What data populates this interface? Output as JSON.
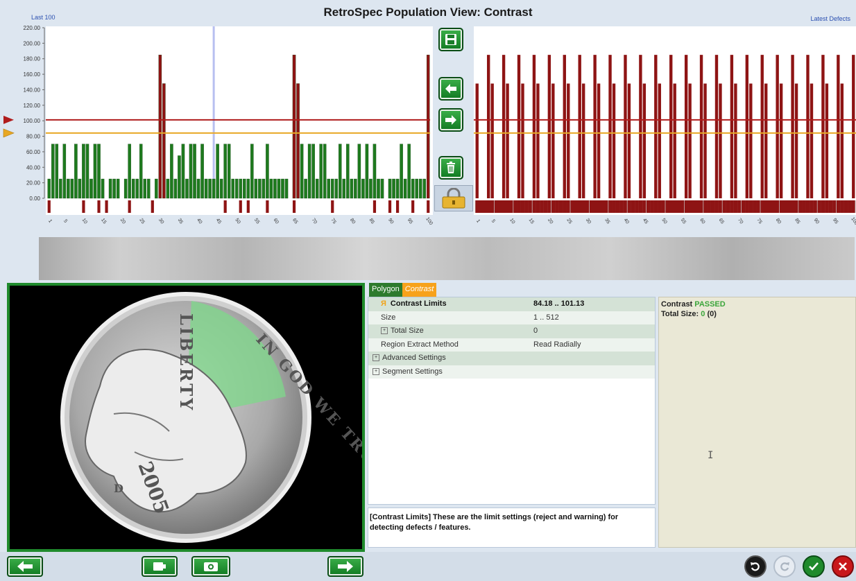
{
  "header": {
    "title": "RetroSpec Population View:  Contrast",
    "left_label": "Last 100",
    "right_label": "Latest Defects"
  },
  "colors": {
    "reject": "#b01c1c",
    "warning": "#e8a824",
    "pass_bar": "#1e7a1e",
    "defect_bar": "#8e1414",
    "accent_green": "#1f8a2c"
  },
  "chart_data": [
    {
      "type": "bar",
      "title": "Last 100",
      "yticks": [
        "220.00",
        "200.00",
        "180.00",
        "160.00",
        "140.00",
        "120.00",
        "100.00",
        "80.00",
        "60.00",
        "40.00",
        "20.00",
        "0.00"
      ],
      "xticks": [
        "1",
        "5",
        "10",
        "15",
        "20",
        "25",
        "30",
        "35",
        "40",
        "45",
        "50",
        "55",
        "60",
        "65",
        "70",
        "75",
        "80",
        "85",
        "90",
        "95",
        "100"
      ],
      "ylim": [
        0,
        220
      ],
      "reject_limit": 101.13,
      "warning_limit": 84.18,
      "cursor_x": 44,
      "values": [
        25,
        70,
        70,
        25,
        70,
        25,
        25,
        70,
        25,
        70,
        70,
        25,
        70,
        70,
        25,
        0,
        25,
        25,
        25,
        0,
        25,
        70,
        25,
        25,
        70,
        25,
        25,
        0,
        25,
        185,
        148,
        25,
        70,
        25,
        55,
        70,
        25,
        70,
        70,
        25,
        70,
        25,
        25,
        25,
        70,
        25,
        70,
        70,
        25,
        25,
        25,
        25,
        25,
        70,
        25,
        25,
        25,
        70,
        25,
        25,
        25,
        25,
        25,
        0,
        185,
        148,
        70,
        25,
        70,
        70,
        25,
        70,
        70,
        25,
        25,
        25,
        70,
        25,
        70,
        25,
        25,
        70,
        25,
        70,
        25,
        70,
        25,
        25,
        0,
        25,
        25,
        25,
        70,
        25,
        70,
        25,
        25,
        25,
        25,
        185
      ],
      "flags": [
        1,
        0,
        0,
        0,
        0,
        0,
        0,
        0,
        0,
        1,
        0,
        0,
        0,
        1,
        0,
        1,
        0,
        0,
        0,
        0,
        0,
        1,
        0,
        0,
        0,
        0,
        0,
        1,
        0,
        0,
        0,
        0,
        0,
        0,
        0,
        0,
        0,
        0,
        0,
        0,
        0,
        0,
        0,
        0,
        0,
        0,
        1,
        0,
        0,
        0,
        1,
        0,
        1,
        0,
        0,
        0,
        0,
        1,
        0,
        0,
        0,
        0,
        0,
        0,
        1,
        0,
        0,
        0,
        0,
        0,
        0,
        0,
        0,
        0,
        1,
        0,
        0,
        0,
        0,
        0,
        0,
        0,
        0,
        0,
        0,
        1,
        0,
        0,
        0,
        1,
        0,
        1,
        0,
        0,
        0,
        1,
        0,
        0,
        0,
        1
      ]
    },
    {
      "type": "bar",
      "title": "Latest Defects",
      "xticks": [
        "1",
        "5",
        "10",
        "15",
        "20",
        "25",
        "30",
        "35",
        "40",
        "45",
        "50",
        "55",
        "60",
        "65",
        "70",
        "75",
        "80",
        "85",
        "90",
        "95",
        "100"
      ],
      "ylim": [
        0,
        220
      ],
      "reject_limit": 101.13,
      "warning_limit": 84.18,
      "values": [
        148,
        0,
        0,
        185,
        148,
        0,
        0,
        185,
        148,
        0,
        0,
        185,
        148,
        0,
        0,
        185,
        148,
        0,
        0,
        185,
        148,
        0,
        0,
        185,
        148,
        0,
        0,
        185,
        148,
        0,
        0,
        185,
        148,
        0,
        0,
        185,
        148,
        0,
        0,
        185,
        148,
        0,
        0,
        185,
        148,
        0,
        0,
        185,
        148,
        0,
        0,
        185,
        148,
        0,
        0,
        185,
        148,
        0,
        0,
        185,
        148,
        0,
        0,
        185,
        148,
        0,
        0,
        185,
        148,
        0,
        0,
        185,
        148,
        0,
        0,
        185,
        148,
        0,
        0,
        185,
        148,
        0,
        0,
        185,
        148,
        0,
        0,
        185,
        148,
        0,
        0,
        185,
        148,
        0,
        0,
        185,
        148,
        0,
        0,
        185
      ]
    }
  ],
  "controls": {
    "save": "save-icon",
    "prev": "arrow-left-icon",
    "next": "arrow-right-icon",
    "delete": "trash-icon",
    "lock": "lock-icon"
  },
  "tabs": [
    {
      "label": "Polygon"
    },
    {
      "label": "Contrast"
    }
  ],
  "settings": [
    {
      "key": "Contrast Limits",
      "value": "84.18 .. 101.13",
      "bold": true,
      "icon": "limits-icon"
    },
    {
      "key": "Size",
      "value": "1 .. 512"
    },
    {
      "key": "Total Size",
      "value": "0",
      "expander": true
    },
    {
      "key": "Region Extract Method",
      "value": "Read Radially"
    },
    {
      "key": "Advanced Settings",
      "value": "",
      "expander": true
    },
    {
      "key": "Segment Settings",
      "value": "",
      "expander": true
    }
  ],
  "description": "[Contrast Limits] These are the limit settings (reject and warning) for detecting defects / features.",
  "result": {
    "label": "Contrast",
    "status": "PASSED",
    "total_label": "Total Size:",
    "total_value": "0",
    "total_paren": "(0)"
  },
  "coin": {
    "liberty": "LIBERTY",
    "motto": "IN GOD WE TRUST",
    "year": "2005",
    "mint": "D"
  }
}
